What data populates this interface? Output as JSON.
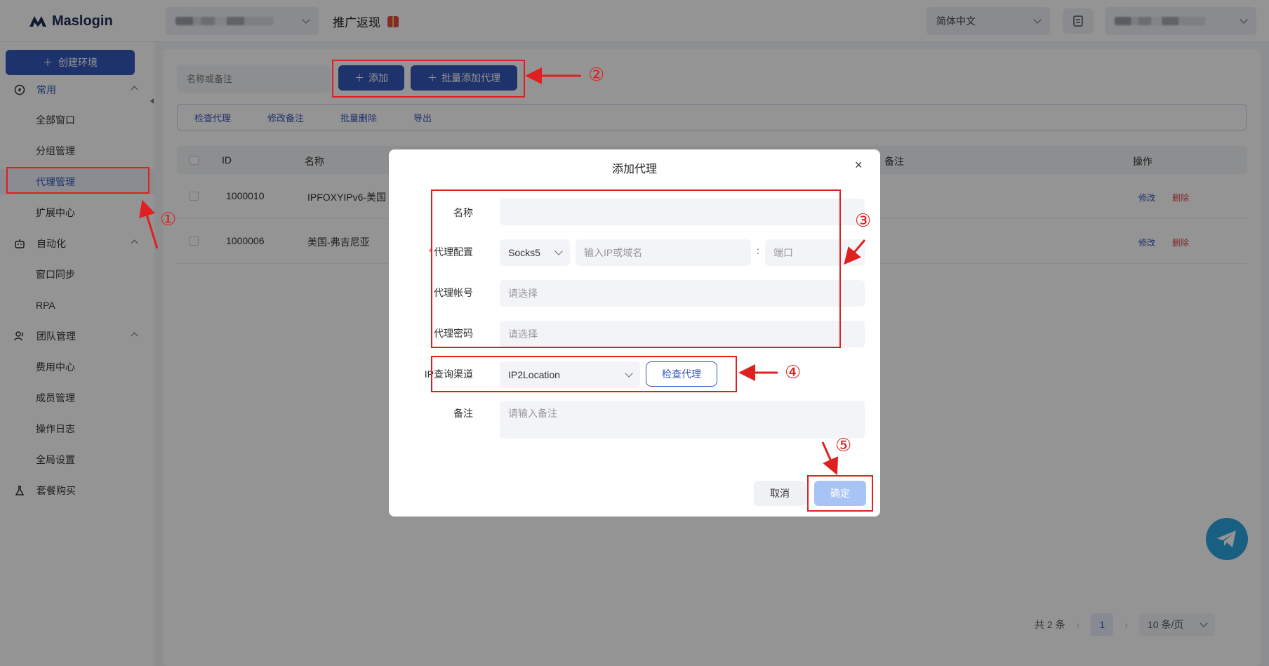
{
  "header": {
    "brand": "Maslogin",
    "promo_label": "推广返现",
    "language": "简体中文"
  },
  "sidebar": {
    "create_label": "创建环境",
    "groups": [
      {
        "label": "常用",
        "items": [
          "全部窗口",
          "分组管理",
          "代理管理",
          "扩展中心"
        ]
      },
      {
        "label": "自动化",
        "items": [
          "窗口同步",
          "RPA"
        ]
      },
      {
        "label": "团队管理",
        "items": [
          "费用中心",
          "成员管理",
          "操作日志",
          "全局设置"
        ]
      },
      {
        "label": "套餐购买",
        "items": []
      }
    ],
    "active_item": "代理管理"
  },
  "main": {
    "search_placeholder": "名称或备注",
    "add_label": "添加",
    "batch_add_label": "批量添加代理",
    "toolbar": [
      "检查代理",
      "修改备注",
      "批量删除",
      "导出"
    ],
    "columns": {
      "id": "ID",
      "name": "名称",
      "remark": "备注",
      "ops": "操作"
    },
    "rows": [
      {
        "id": "1000010",
        "name": "IPFOXYIPv6-美国",
        "edit": "修改",
        "delete": "删除"
      },
      {
        "id": "1000006",
        "name": "美国-弗吉尼亚",
        "edit": "修改",
        "delete": "删除"
      }
    ],
    "pagination": {
      "total": "共 2 条",
      "page": "1",
      "page_size": "10 条/页"
    }
  },
  "dialog": {
    "title": "添加代理",
    "close": "×",
    "fields": {
      "name_label": "名称",
      "proxy_config_label": "代理配置",
      "proxy_type": "Socks5",
      "host_placeholder": "输入IP或域名",
      "colon": ":",
      "port_placeholder": "端口",
      "account_label": "代理帐号",
      "account_placeholder": "请选择",
      "password_label": "代理密码",
      "password_placeholder": "请选择",
      "ip_channel_label": "IP查询渠道",
      "ip_channel_value": "IP2Location",
      "check_proxy_label": "检查代理",
      "remark_label": "备注",
      "remark_placeholder": "请输入备注"
    },
    "cancel_label": "取消",
    "ok_label": "确定"
  },
  "annotations": [
    "①",
    "②",
    "③",
    "④",
    "⑤"
  ],
  "colors": {
    "primary": "#3556b8",
    "annotation": "#e02020",
    "danger": "#e04a4a",
    "telegram": "#2aa4e0"
  }
}
